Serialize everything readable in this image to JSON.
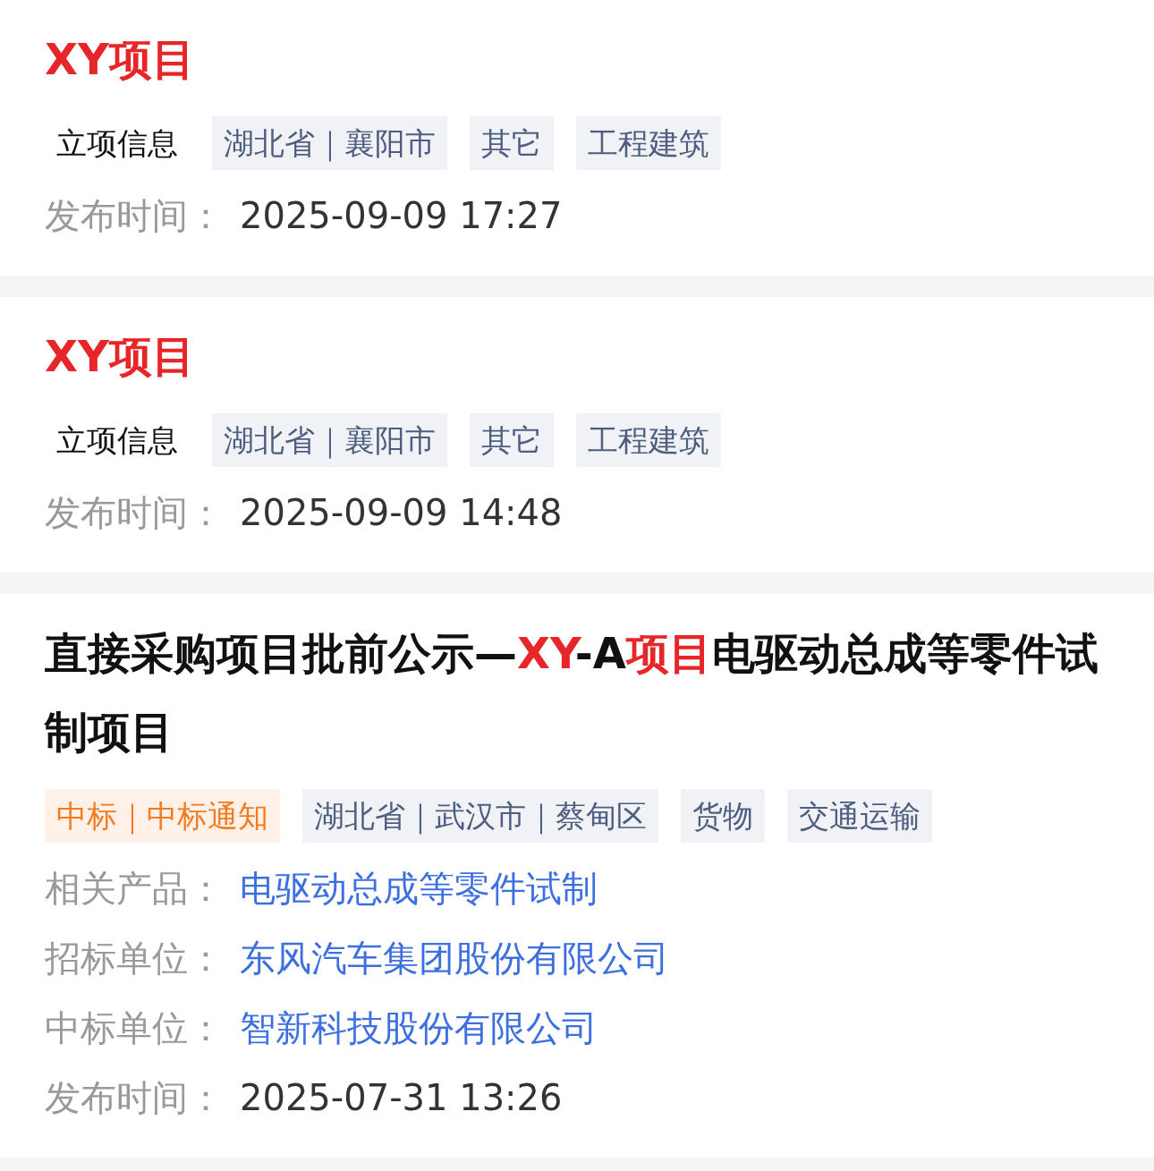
{
  "cards": [
    {
      "title": [
        {
          "text": "XY项目",
          "highlight": true
        }
      ],
      "tags": [
        {
          "text": "立项信息",
          "kind": "plain"
        },
        {
          "text": "湖北省｜襄阳市",
          "kind": "info"
        },
        {
          "text": "其它",
          "kind": "info"
        },
        {
          "text": "工程建筑",
          "kind": "info"
        }
      ],
      "fields": [
        {
          "label": "发布时间：",
          "value": "2025-09-09 17:27",
          "kind": "text"
        }
      ]
    },
    {
      "title": [
        {
          "text": "XY项目",
          "highlight": true
        }
      ],
      "tags": [
        {
          "text": "立项信息",
          "kind": "plain"
        },
        {
          "text": "湖北省｜襄阳市",
          "kind": "info"
        },
        {
          "text": "其它",
          "kind": "info"
        },
        {
          "text": "工程建筑",
          "kind": "info"
        }
      ],
      "fields": [
        {
          "label": "发布时间：",
          "value": "2025-09-09 14:48",
          "kind": "text"
        }
      ]
    },
    {
      "title": [
        {
          "text": "直接采购项目批前公示—",
          "highlight": false
        },
        {
          "text": "XY",
          "highlight": true
        },
        {
          "text": "-A",
          "highlight": false
        },
        {
          "text": "项目",
          "highlight": true
        },
        {
          "text": "电驱动总成等零件试制项目",
          "highlight": false
        }
      ],
      "tags": [
        {
          "text": "中标｜中标通知",
          "kind": "status"
        },
        {
          "text": "湖北省｜武汉市｜蔡甸区",
          "kind": "info"
        },
        {
          "text": "货物",
          "kind": "info"
        },
        {
          "text": "交通运输",
          "kind": "info"
        }
      ],
      "fields": [
        {
          "label": "相关产品：",
          "value": "电驱动总成等零件试制",
          "kind": "link"
        },
        {
          "label": "招标单位：",
          "value": "东风汽车集团股份有限公司",
          "kind": "link"
        },
        {
          "label": "中标单位：",
          "value": "智新科技股份有限公司",
          "kind": "link"
        },
        {
          "label": "发布时间：",
          "value": "2025-07-31 13:26",
          "kind": "text"
        }
      ]
    }
  ]
}
